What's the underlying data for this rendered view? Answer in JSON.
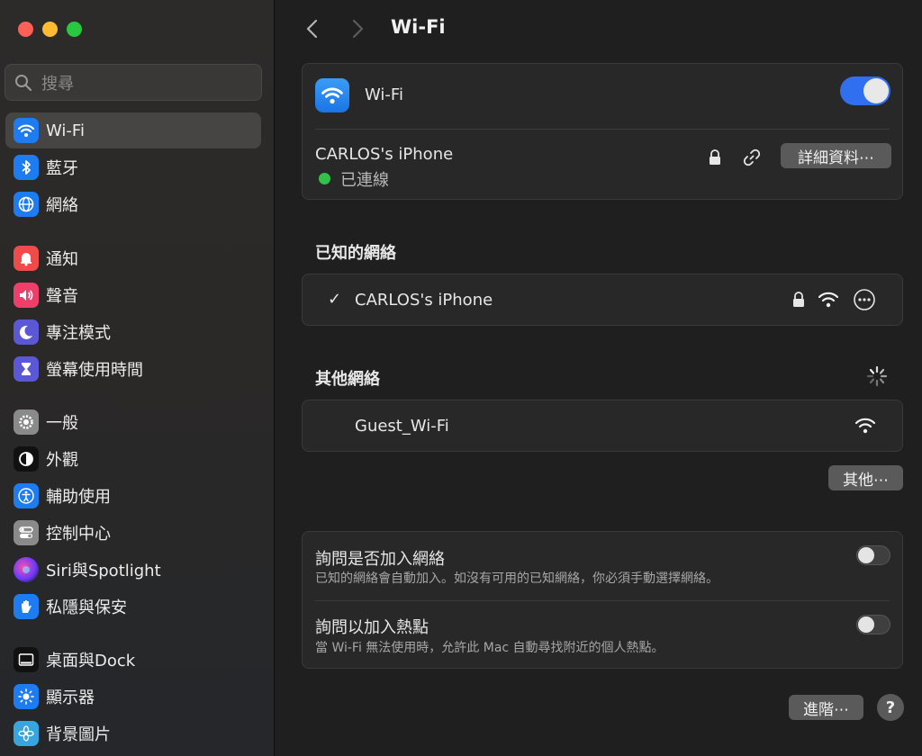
{
  "window": {
    "title": "Wi-Fi"
  },
  "sidebar": {
    "search_placeholder": "搜尋",
    "items": [
      {
        "label": "Wi-Fi",
        "icon": "wifi-icon",
        "color": "#1e7cf2"
      },
      {
        "label": "藍牙",
        "icon": "bluetooth-icon",
        "color": "#1e7cf2"
      },
      {
        "label": "網絡",
        "icon": "globe-icon",
        "color": "#1e7cf2"
      },
      {
        "label": "通知",
        "icon": "bell-icon",
        "color": "#ee4b4b"
      },
      {
        "label": "聲音",
        "icon": "speaker-icon",
        "color": "#ee3f6a"
      },
      {
        "label": "專注模式",
        "icon": "moon-icon",
        "color": "#5b58d6"
      },
      {
        "label": "螢幕使用時間",
        "icon": "hourglass-icon",
        "color": "#5b58d6"
      },
      {
        "label": "一般",
        "icon": "gear-icon",
        "color": "#8a8a8a"
      },
      {
        "label": "外觀",
        "icon": "appearance-icon",
        "color": "#111111"
      },
      {
        "label": "輔助使用",
        "icon": "accessibility-icon",
        "color": "#1e7cf2"
      },
      {
        "label": "控制中心",
        "icon": "control-center-icon",
        "color": "#8a8a8a"
      },
      {
        "label": "Siri與Spotlight",
        "icon": "siri-icon",
        "color": "#2a2a3a"
      },
      {
        "label": "私隱與保安",
        "icon": "hand-icon",
        "color": "#1e7cf2"
      },
      {
        "label": "桌面與Dock",
        "icon": "dock-icon",
        "color": "#111111"
      },
      {
        "label": "顯示器",
        "icon": "sun-icon",
        "color": "#1e7cf2"
      },
      {
        "label": "背景圖片",
        "icon": "flower-icon",
        "color": "#35a7e0"
      }
    ]
  },
  "main": {
    "title": "Wi-Fi",
    "wifi_card": {
      "label": "Wi-Fi",
      "toggle_on": true,
      "connected_network": "CARLOS's iPhone",
      "status": "已連線",
      "details_button": "詳細資料⋯"
    },
    "known_networks": {
      "title": "已知的網絡",
      "items": [
        {
          "name": "CARLOS's iPhone",
          "check": "✓",
          "locked": true
        }
      ]
    },
    "other_networks": {
      "title": "其他網絡",
      "items": [
        {
          "name": "Guest_Wi-Fi",
          "locked": false
        }
      ],
      "other_button": "其他⋯"
    },
    "settings": {
      "ask_join_title": "詢問是否加入網絡",
      "ask_join_desc": "已知的網絡會自動加入。如沒有可用的已知網絡，你必須手動選擇網絡。",
      "ask_hotspot_title": "詢問以加入熱點",
      "ask_hotspot_desc": "當 Wi-Fi 無法使用時，允許此 Mac 自動尋找附近的個人熱點。"
    },
    "advanced_button": "進階⋯",
    "help_button": "?"
  }
}
